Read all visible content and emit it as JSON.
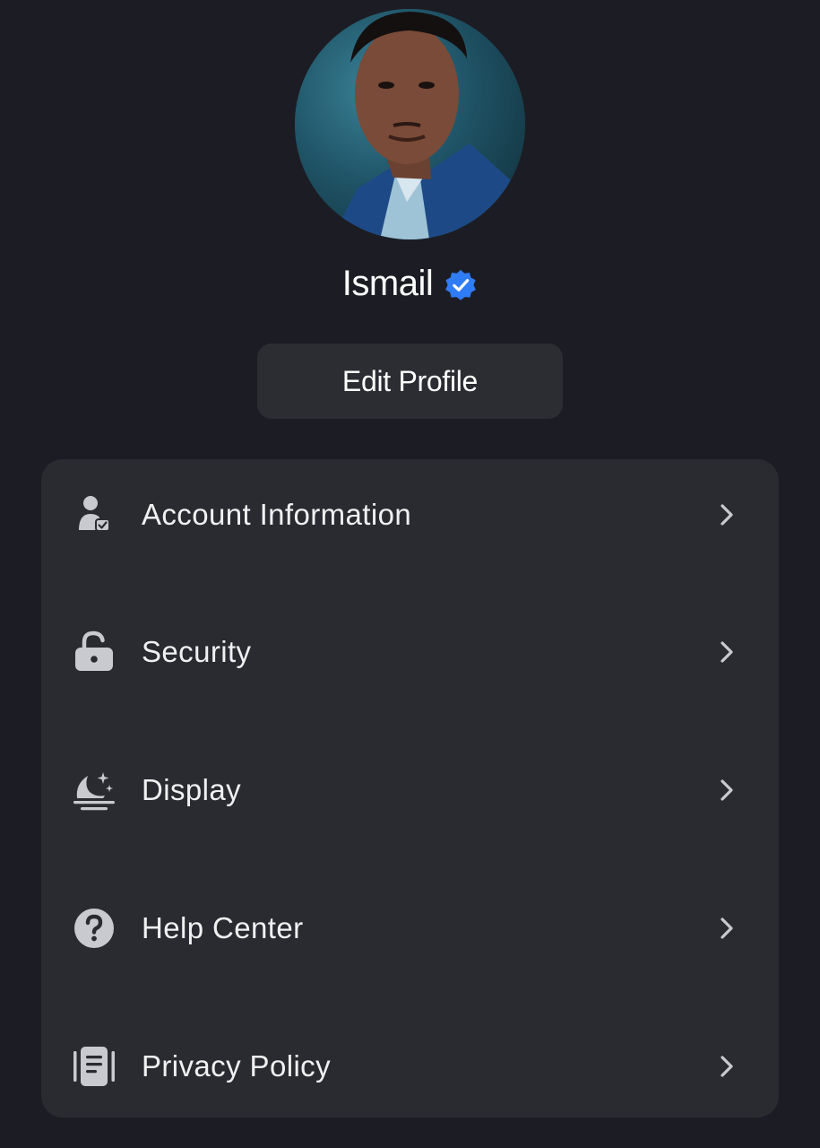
{
  "profile": {
    "name": "Ismail",
    "verified": true,
    "verified_color": "#2f7cf6"
  },
  "actions": {
    "edit_profile_label": "Edit Profile"
  },
  "menu": {
    "items": [
      {
        "label": "Account Information",
        "icon": "user-check-icon"
      },
      {
        "label": "Security",
        "icon": "unlock-icon"
      },
      {
        "label": "Display",
        "icon": "moon-sparkle-icon"
      },
      {
        "label": "Help Center",
        "icon": "question-circle-icon"
      },
      {
        "label": "Privacy Policy",
        "icon": "document-icon"
      }
    ]
  },
  "colors": {
    "background": "#1c1d24",
    "card": "#2a2b31",
    "button": "#2c2d33",
    "icon": "#c9cacf",
    "text": "#f0f0f2"
  }
}
